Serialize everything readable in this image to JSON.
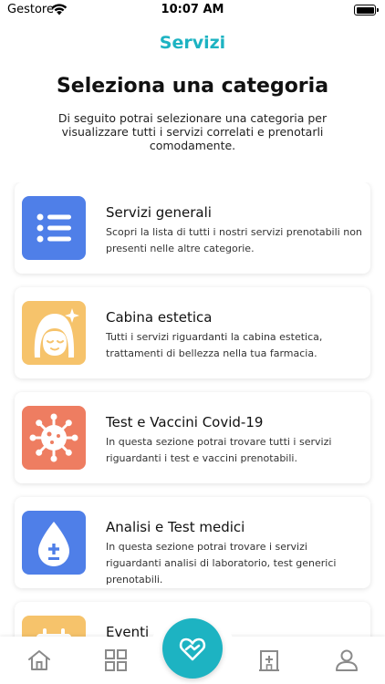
{
  "status_bar": {
    "carrier": "Gestore",
    "time": "10:07 AM"
  },
  "nav": {
    "title": "Servizi"
  },
  "heading": "Seleziona una categoria",
  "intro": "Di seguito potrai selezionare una categoria per visualizzare tutti i servizi correlati e prenotarli comodamente.",
  "categories": [
    {
      "title": "Servizi generali",
      "description": "Scopri la lista di tutti i nostri servizi prenotabili non presenti nelle altre categorie.",
      "icon": "list-icon",
      "color": "#4f7fe8"
    },
    {
      "title": "Cabina estetica",
      "description": "Tutti i servizi riguardanti la cabina estetica, trattamenti di bellezza nella tua farmacia.",
      "icon": "face-sparkle-icon",
      "color": "#f6c36b"
    },
    {
      "title": "Test e Vaccini Covid-19",
      "description": "In questa sezione potrai trovare tutti i servizi riguardanti i test e vaccini prenotabili.",
      "icon": "virus-icon",
      "color": "#ee7d61"
    },
    {
      "title": "Analisi e Test medici",
      "description": "In questa sezione potrai trovare i servizi riguardanti analisi di laboratorio, test generici prenotabili.",
      "icon": "blood-drop-icon",
      "color": "#4f7fe8"
    },
    {
      "title": "Eventi",
      "description": "",
      "icon": "calendar-icon",
      "color": "#f6c36b"
    }
  ],
  "tab_bar": {
    "accent": "#1db3c2",
    "tabs": [
      {
        "icon": "home-icon"
      },
      {
        "icon": "grid-icon"
      },
      {
        "icon": "heart-hands-icon"
      },
      {
        "icon": "pharmacy-icon"
      },
      {
        "icon": "user-icon"
      }
    ]
  }
}
